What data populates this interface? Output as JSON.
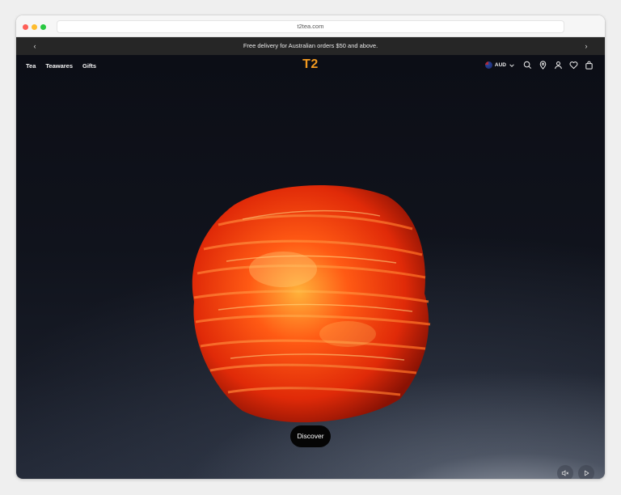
{
  "browser": {
    "url": "t2tea.com"
  },
  "announcement": {
    "text": "Free delivery for Australian orders $50 and above."
  },
  "nav": {
    "items": [
      "Tea",
      "Teawares",
      "Gifts"
    ],
    "logo": "T2",
    "currency": "AUD"
  },
  "hero": {
    "cta_label": "Discover"
  },
  "icons": {
    "prev": "chevron-left-icon",
    "next": "chevron-right-icon",
    "search": "search-icon",
    "store": "location-pin-icon",
    "account": "user-icon",
    "wishlist": "heart-icon",
    "cart": "shopping-bag-icon",
    "mute": "volume-muted-icon",
    "play": "play-icon"
  },
  "colors": {
    "brand_orange": "#f39a1f",
    "announcement_bg": "#262626",
    "cta_bg": "#050505"
  }
}
